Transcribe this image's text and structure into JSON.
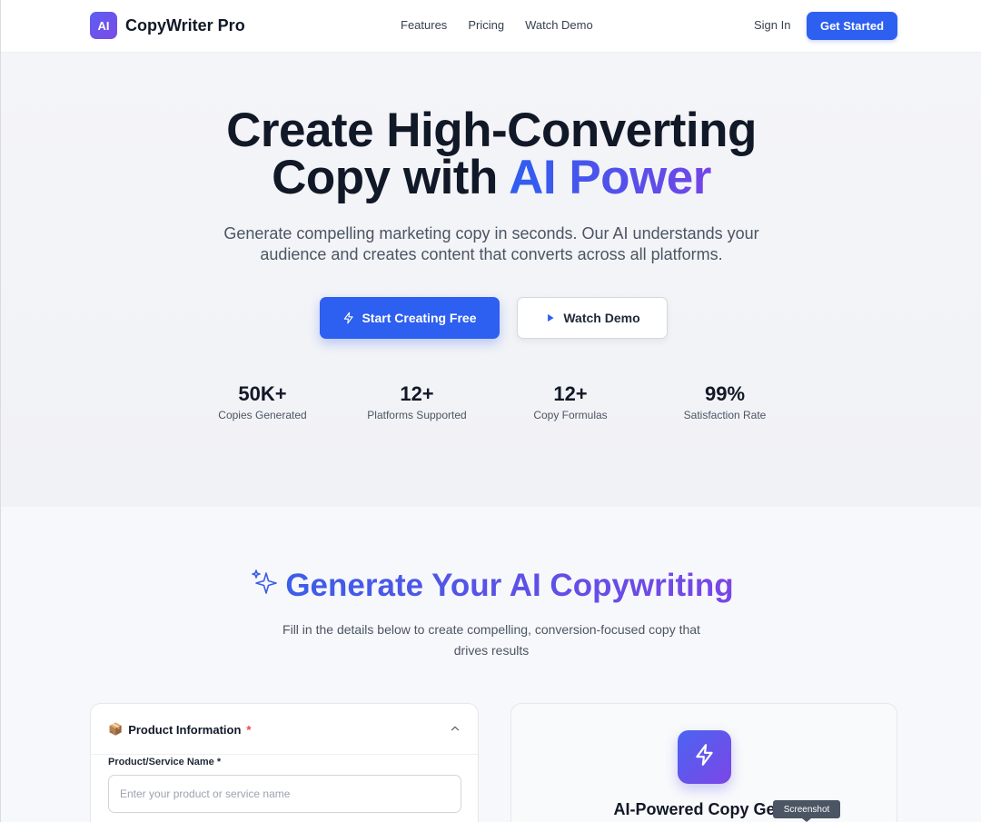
{
  "brand": {
    "logo_text": "AI",
    "name": "CopyWriter Pro"
  },
  "nav": {
    "links": [
      "Features",
      "Pricing",
      "Watch Demo"
    ],
    "sign_in": "Sign In",
    "get_started": "Get Started"
  },
  "hero": {
    "title_line1": "Create High-Converting",
    "title_line2_plain": "Copy with ",
    "title_line2_accent": "AI Power",
    "subtitle_line1": "Generate compelling marketing copy in seconds. Our AI understands your",
    "subtitle_line2": "audience and creates content that converts across all platforms.",
    "cta_primary": "Start Creating Free",
    "cta_secondary": "Watch Demo",
    "stats": [
      {
        "value": "50K+",
        "label": "Copies Generated"
      },
      {
        "value": "12+",
        "label": "Platforms Supported"
      },
      {
        "value": "12+",
        "label": "Copy Formulas"
      },
      {
        "value": "99%",
        "label": "Satisfaction Rate"
      }
    ]
  },
  "generator": {
    "title": "Generate Your AI Copywriting",
    "subtitle_line1": "Fill in the details below to create compelling, conversion-focused copy that",
    "subtitle_line2": "drives results"
  },
  "product_card": {
    "icon": "📦",
    "title": "Product Information",
    "required_mark": "*",
    "field_label": "Product/Service Name *",
    "field_placeholder": "Enter your product or service name",
    "field_value": ""
  },
  "ai_card": {
    "title": "AI-Powered Copy Gene"
  },
  "tooltip": {
    "text": "Screenshot"
  },
  "colors": {
    "primary": "#2d5ff0",
    "accent_gradient_start": "#2d5ff0",
    "accent_gradient_end": "#7445e6",
    "required": "#ef4444"
  }
}
